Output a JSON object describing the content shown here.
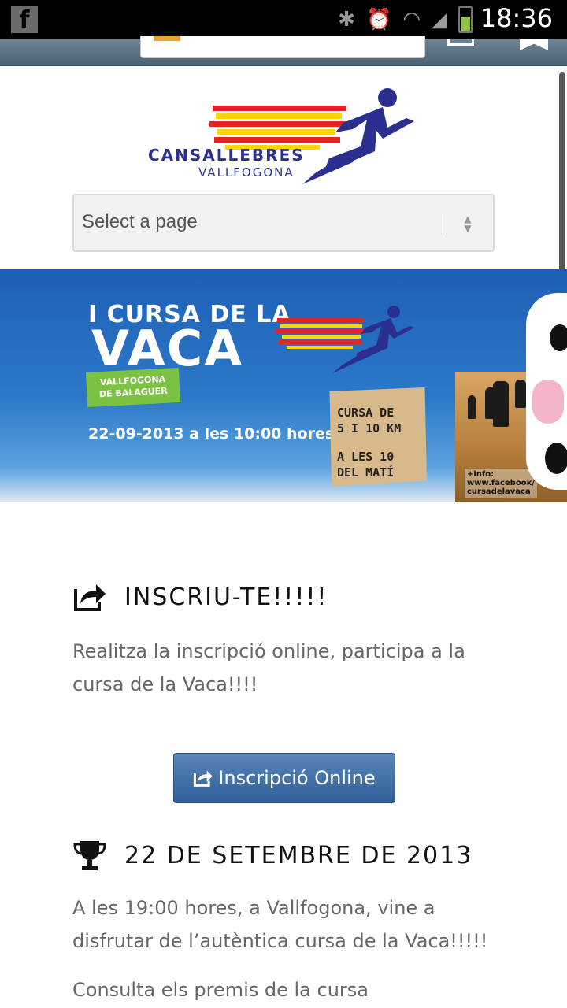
{
  "status_bar": {
    "time": "18:36",
    "app_icon": "facebook-icon",
    "icons": [
      "bluetooth-icon",
      "alarm-icon",
      "wifi-icon",
      "signal-icon",
      "battery-icon"
    ]
  },
  "browser": {
    "icons": [
      "site-icon",
      "tab-icon",
      "bookmark-icon"
    ]
  },
  "header": {
    "logo_text_main": "CANSALLEBRES",
    "logo_text_sub": "VALLFOGONA",
    "select_placeholder": "Select a page"
  },
  "banner": {
    "title_top": "I CURSA DE LA",
    "title_main": "VACA",
    "place_line1": "VALLFOGONA",
    "place_line2": "DE BALAGUER",
    "date": "22-09-2013 a les 10:00 hores",
    "sign_line1": "CURSA DE",
    "sign_line2": "5 I 10 KM",
    "sign_line3": "A LES 10",
    "sign_line4": "DEL MATÍ",
    "info_line1": "+info:",
    "info_line2": "www.facebook/",
    "info_line3": "cursadelavaca"
  },
  "sections": [
    {
      "icon": "share-icon",
      "title": "INSCRIU-TE!!!!!",
      "text": "Realitza la inscripció online, participa a la cursa de la Vaca!!!!",
      "button_label": "Inscripció Online",
      "button_icon": "share-icon"
    },
    {
      "icon": "trophy-icon",
      "title": "22 DE SETEMBRE DE 2013",
      "text": "A les 19:00 hores, a Vallfogona, vine a disfrutar de l’autèntica cursa de la Vaca!!!!!",
      "text2": "Consulta els premis de la cursa"
    }
  ],
  "colors": {
    "status_bar": "#000000",
    "browser_bar": "#5a7286",
    "banner_sky": "#2c79c9",
    "button": "#3a6aa3",
    "body_text": "#666666",
    "heading_text": "#111111"
  }
}
